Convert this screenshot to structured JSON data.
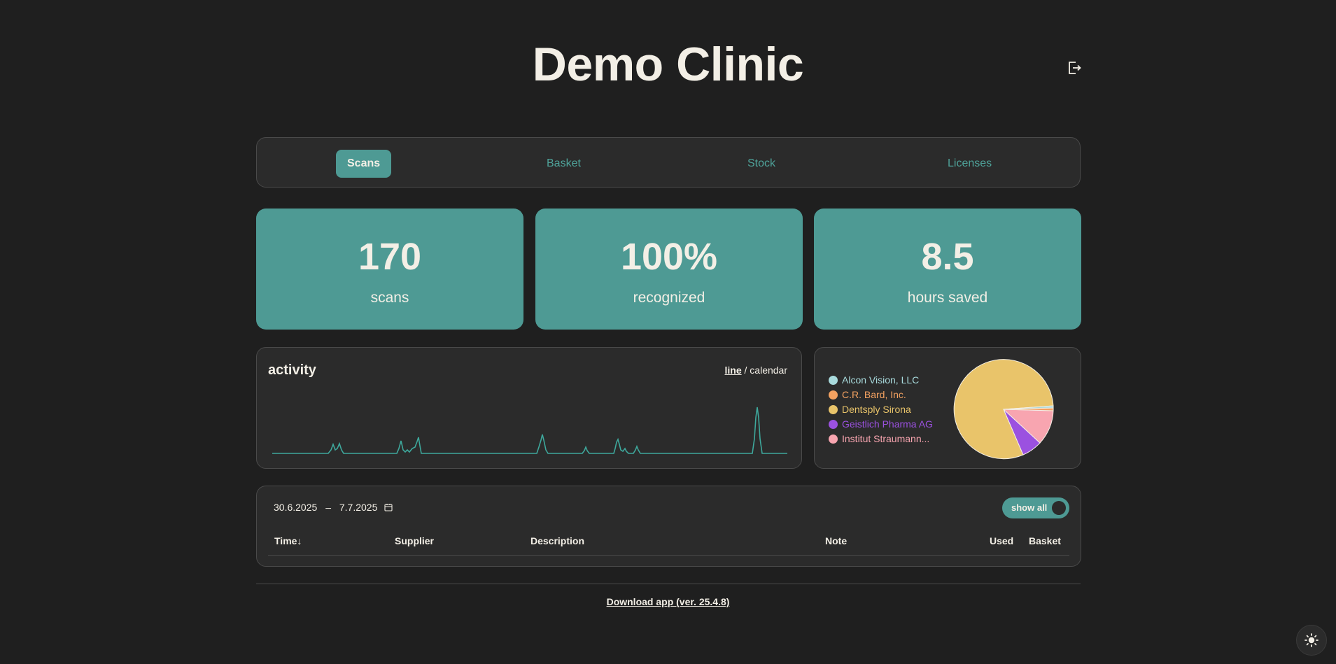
{
  "header": {
    "title": "Demo Clinic",
    "logout_icon": "logout-icon"
  },
  "nav": {
    "tabs": [
      {
        "label": "Scans",
        "active": true
      },
      {
        "label": "Basket",
        "active": false
      },
      {
        "label": "Stock",
        "active": false
      },
      {
        "label": "Licenses",
        "active": false
      }
    ]
  },
  "stats": [
    {
      "value": "170",
      "label": "scans"
    },
    {
      "value": "100%",
      "label": "recognized"
    },
    {
      "value": "8.5",
      "label": "hours saved"
    }
  ],
  "activity": {
    "title": "activity",
    "view_line": "line",
    "view_separator": " / ",
    "view_calendar": "calendar",
    "line_color": "#3ea89c"
  },
  "suppliers_legend": [
    {
      "name": "Alcon Vision, LLC",
      "color": "#a8dadc"
    },
    {
      "name": "C.R. Bard, Inc.",
      "color": "#f4a261"
    },
    {
      "name": "Dentsply Sirona",
      "color": "#e9c46a"
    },
    {
      "name": "Geistlich Pharma AG",
      "color": "#9b51e0"
    },
    {
      "name": "Institut Straumann...",
      "color": "#f8a5b0"
    }
  ],
  "scans_table": {
    "date_from": "30.6.2025",
    "date_separator": "–",
    "date_to": "7.7.2025",
    "calendar_icon": "calendar-icon",
    "show_all_label": "show all",
    "columns": [
      "Time↓",
      "Supplier",
      "Description",
      "Note",
      "Used",
      "Basket"
    ]
  },
  "footer": {
    "download_label": "Download app (ver. 25.4.8)"
  },
  "theme_toggle_icon": "sun-icon"
}
